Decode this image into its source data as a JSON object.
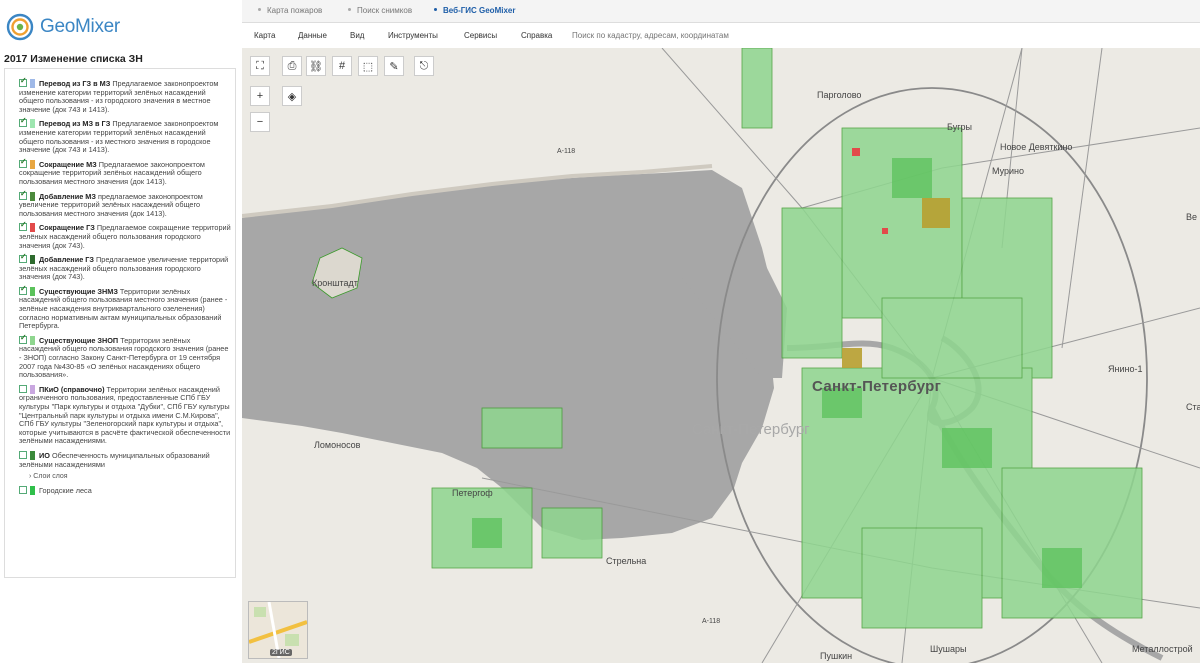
{
  "logo": {
    "brand": "GeoMixer"
  },
  "project_title": "2017 Изменение списка ЗН",
  "layers": [
    {
      "checked": true,
      "color": "#9fb9e8",
      "name": "Перевод из ГЗ в МЗ",
      "desc": "Предлагаемое законопроектом изменение категории территорий зелёных насаждений общего пользования - из городского значения в местное значение (док 743 и 1413)."
    },
    {
      "checked": true,
      "color": "#9ee6b0",
      "name": "Перевод из МЗ в ГЗ",
      "desc": "Предлагаемое законопроектом изменение категории территорий зелёных насаждений общего пользования - из местного значения в городское значение (док 743 и 1413)."
    },
    {
      "checked": true,
      "color": "#e8a640",
      "name": "Сокращение МЗ",
      "desc": "Предлагаемое законопроектом сокращение территорий зелёных насаждений общего пользования местного значения (док 1413)."
    },
    {
      "checked": true,
      "color": "#4c8a3c",
      "name": "Добавление МЗ",
      "desc": "предлагаемое законопроектом увеличение территорий зелёных насаждений общего пользования местного значения (док 1413)."
    },
    {
      "checked": true,
      "color": "#e24a4a",
      "name": "Сокращение ГЗ",
      "desc": "Предлагаемое сокращение территорий зелёных насаждений общего пользования городского значения (док 743)."
    },
    {
      "checked": true,
      "color": "#2e6b2e",
      "name": "Добавление ГЗ",
      "desc": "Предлагаемое увеличение территорий зелёных насаждений общего пользования городского значения (док 743)."
    },
    {
      "checked": true,
      "color": "#5bc25b",
      "name": "Существующие ЗНМЗ",
      "desc": "Территории зелёных насаждений общего пользования местного значения (ранее - зелёные насаждения внутриквартального озеленения) согласно нормативным актам муниципальных образований Петербурга."
    },
    {
      "checked": true,
      "color": "#8fd68f",
      "name": "Существующие ЗНОП",
      "desc": "Территории зелёных насаждений общего пользования городского значения (ранее - ЗНОП) согласно Закону Санкт-Петербурга от 19 сентября 2007 года №430-85 «О зелёных насаждениях общего пользования»."
    },
    {
      "checked": false,
      "color": "#c9a7e0",
      "name": "ПКиО (справочно)",
      "desc": "Территории зелёных насаждений ограниченного пользования, предоставленные СПб ГБУ культуры \"Парк культуры и отдыха \"Дубки\", СПб ГБУ культуры \"Центральный парк культуры и отдыха имени С.М.Кирова\", СПб ГБУ культуры \"Зеленогорский парк культуры и отдыха\", которые учитываются в расчёте фактической обеспеченности зелёными насаждениями."
    },
    {
      "checked": false,
      "color": "#3a8a3a",
      "name": "ИО",
      "desc": "Обеспеченность муниципальных образований зелёными насаждениями"
    }
  ],
  "sublayer_link": "Слои слоя",
  "last_layer": {
    "checked": false,
    "color": "#2fbf4a",
    "name": "Городские леса"
  },
  "tabs": [
    {
      "label": "Карта пожаров",
      "active": false
    },
    {
      "label": "Поиск снимков",
      "active": false
    },
    {
      "label": "Веб-ГИС GeoMixer",
      "active": true
    }
  ],
  "menu": [
    "Карта",
    "Данные",
    "Вид",
    "Инструменты",
    "Сервисы",
    "Справка"
  ],
  "search": {
    "placeholder": "Поиск по кадастру, адресам, координатам"
  },
  "map_labels": {
    "pargolovo": "Парголово",
    "bugry": "Бугры",
    "novoe_devyatkino": "Новое Девяткино",
    "murino": "Мурино",
    "kronshtadt": "Кронштадт",
    "spb": "Санкт-Петербург",
    "spb_ghost": "Санкт-Петербург",
    "yanino": "Янино-1",
    "lomonosov": "Ломоносов",
    "petergof": "Петергоф",
    "strelna": "Стрельна",
    "shushary": "Шушары",
    "metallostroy": "Металлострой",
    "pushkin": "Пушкин",
    "road_a118_1": "А-118",
    "road_a118_2": "А-118",
    "ve": "Ве",
    "sta": "Ста"
  },
  "minimap": {
    "label": "2ГИС"
  }
}
